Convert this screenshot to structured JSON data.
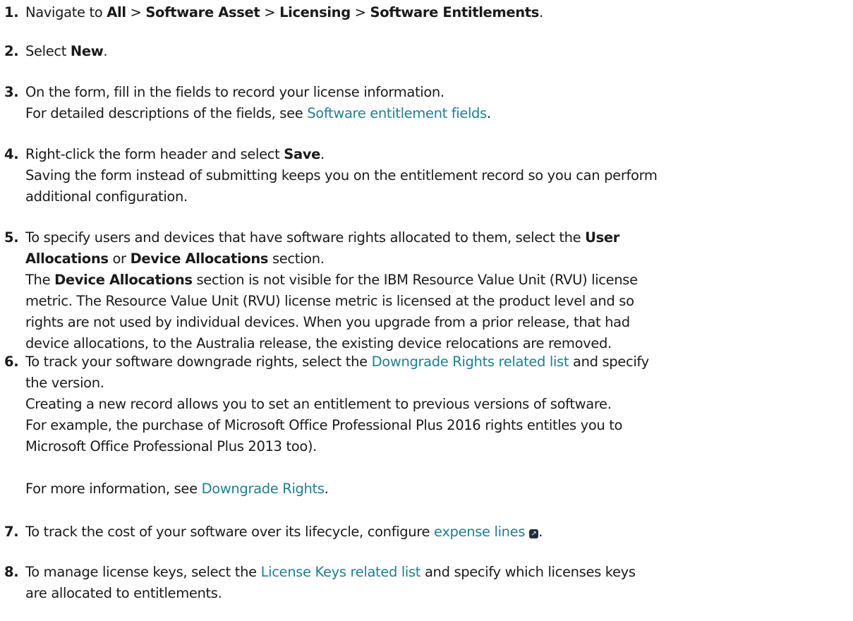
{
  "steps": [
    {
      "number": "1.",
      "nav_prefix": "Navigate to ",
      "path": [
        "All",
        "Software Asset",
        "Licensing",
        "Software Entitlements"
      ],
      "separator": " > ",
      "end": "."
    },
    {
      "number": "2.",
      "prefix": "Select ",
      "bold": "New",
      "end": "."
    },
    {
      "number": "3.",
      "line1": "On the form, fill in the fields to record your license information.",
      "line2_prefix": "For detailed descriptions of the fields, see ",
      "link": "Software entitlement fields",
      "end": "."
    },
    {
      "number": "4.",
      "prefix": "Right-click the form header and select ",
      "bold": "Save",
      "end": ".",
      "line2": "Saving the form instead of submitting keeps you on the entitlement record so you can perform",
      "line3": "additional configuration."
    },
    {
      "number": "5.",
      "prefix": "To specify users and devices that have software rights allocated to them, select the ",
      "bold1": "User",
      "bold1b": "Allocations",
      "middle": " or ",
      "bold2": "Device Allocations",
      "suffix": " section.",
      "para_prefix": "The ",
      "para_bold": "Device Allocations",
      "para_l1": " section is not visible for the IBM Resource Value Unit (RVU) license",
      "para_l2": "metric. The Resource Value Unit (RVU) license metric is licensed at the product level and so",
      "para_l3": "rights are not used by individual devices. When you upgrade from a prior release, that had",
      "para_l4": "device allocations, to the Australia release, the existing device relocations are removed."
    },
    {
      "number": "6.",
      "prefix": "To track your software downgrade rights, select the ",
      "link": "Downgrade Rights related list",
      "suffix": " and specify",
      "line2": "the version.",
      "line3": "Creating a new record allows you to set an entitlement to previous versions of software.",
      "line4": "For example, the purchase of Microsoft Office Professional Plus 2016 rights entitles you to",
      "line5": "Microsoft Office Professional Plus 2013 too).",
      "more_prefix": "For more information, see ",
      "more_link": "Downgrade Rights",
      "more_end": "."
    },
    {
      "number": "7.",
      "prefix": "To track the cost of your software over its lifecycle, configure  ",
      "link": "expense lines",
      "icon": "external-link-icon",
      "end": "."
    },
    {
      "number": "8.",
      "prefix": "To manage license keys, select the ",
      "link": "License Keys related list",
      "suffix": " and specify which licenses keys",
      "line2": "are allocated to entitlements."
    }
  ],
  "colors": {
    "text": "#1a1a1a",
    "link": "#1f7e91",
    "icon_bg": "#1f2d3d"
  }
}
